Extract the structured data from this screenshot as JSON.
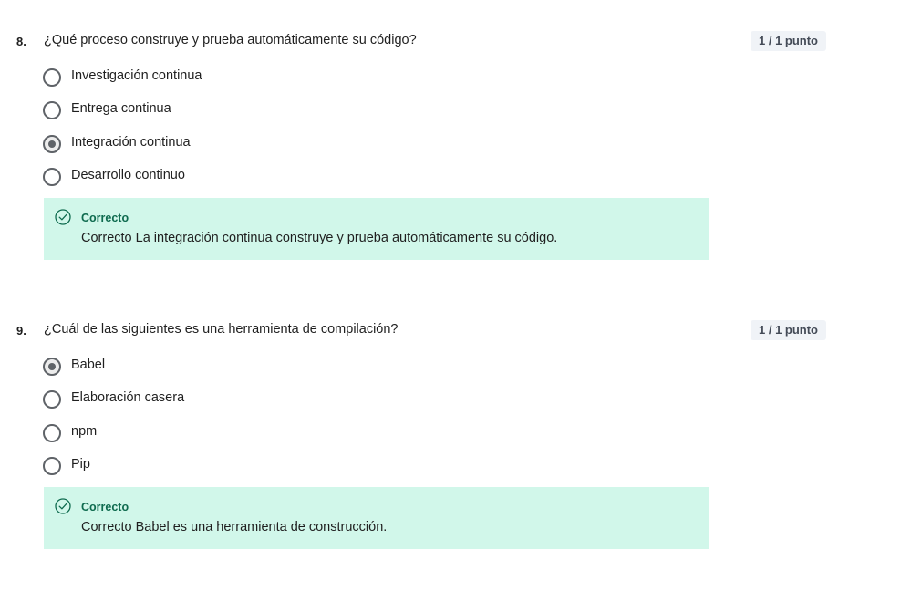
{
  "questions": [
    {
      "number": "8.",
      "text": "¿Qué proceso construye y prueba automáticamente su código?",
      "score": "1 / 1 punto",
      "options": [
        {
          "label": "Investigación continua",
          "selected": false
        },
        {
          "label": "Entrega continua",
          "selected": false
        },
        {
          "label": "Integración continua",
          "selected": true
        },
        {
          "label": "Desarrollo continuo",
          "selected": false
        }
      ],
      "feedback": {
        "status": "Correcto",
        "text": "Correcto La integración continua construye y prueba automáticamente su código.",
        "icon": "check-circle-icon"
      }
    },
    {
      "number": "9.",
      "text": "¿Cuál de las siguientes es una herramienta de compilación?",
      "score": "1 / 1 punto",
      "options": [
        {
          "label": "Babel",
          "selected": true
        },
        {
          "label": "Elaboración casera",
          "selected": false
        },
        {
          "label": "npm",
          "selected": false
        },
        {
          "label": "Pip",
          "selected": false
        }
      ],
      "feedback": {
        "status": "Correcto",
        "text": "Correcto Babel es una herramienta de construcción.",
        "icon": "check-circle-icon"
      }
    }
  ],
  "colors": {
    "feedback_bg": "#d1f7ea",
    "feedback_title": "#0f6b4f",
    "score_bg": "#f0f3f7"
  }
}
